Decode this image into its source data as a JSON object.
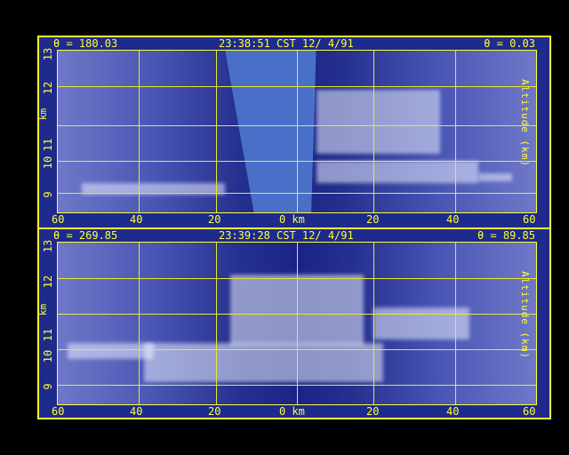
{
  "panels": [
    {
      "theta_left": "θ = 180.03",
      "time": "23:38:51 CST 12/ 4/91",
      "theta_right": "θ = 0.03"
    },
    {
      "theta_left": "θ = 269.85",
      "time": "23:39:28 CST 12/ 4/91",
      "theta_right": "θ = 89.85"
    }
  ],
  "axes": {
    "y_ticks": [
      "13",
      "12",
      "11",
      "10",
      "9"
    ],
    "y_label": "km",
    "right_label": "Altitude (km)",
    "x_ticks": [
      "60",
      "40",
      "20",
      "0 km",
      "20",
      "40",
      "60"
    ]
  },
  "colors": {
    "background": "#000000",
    "panel": "#1e2a8c",
    "grid": "#ffff33",
    "text": "#ffff33"
  }
}
